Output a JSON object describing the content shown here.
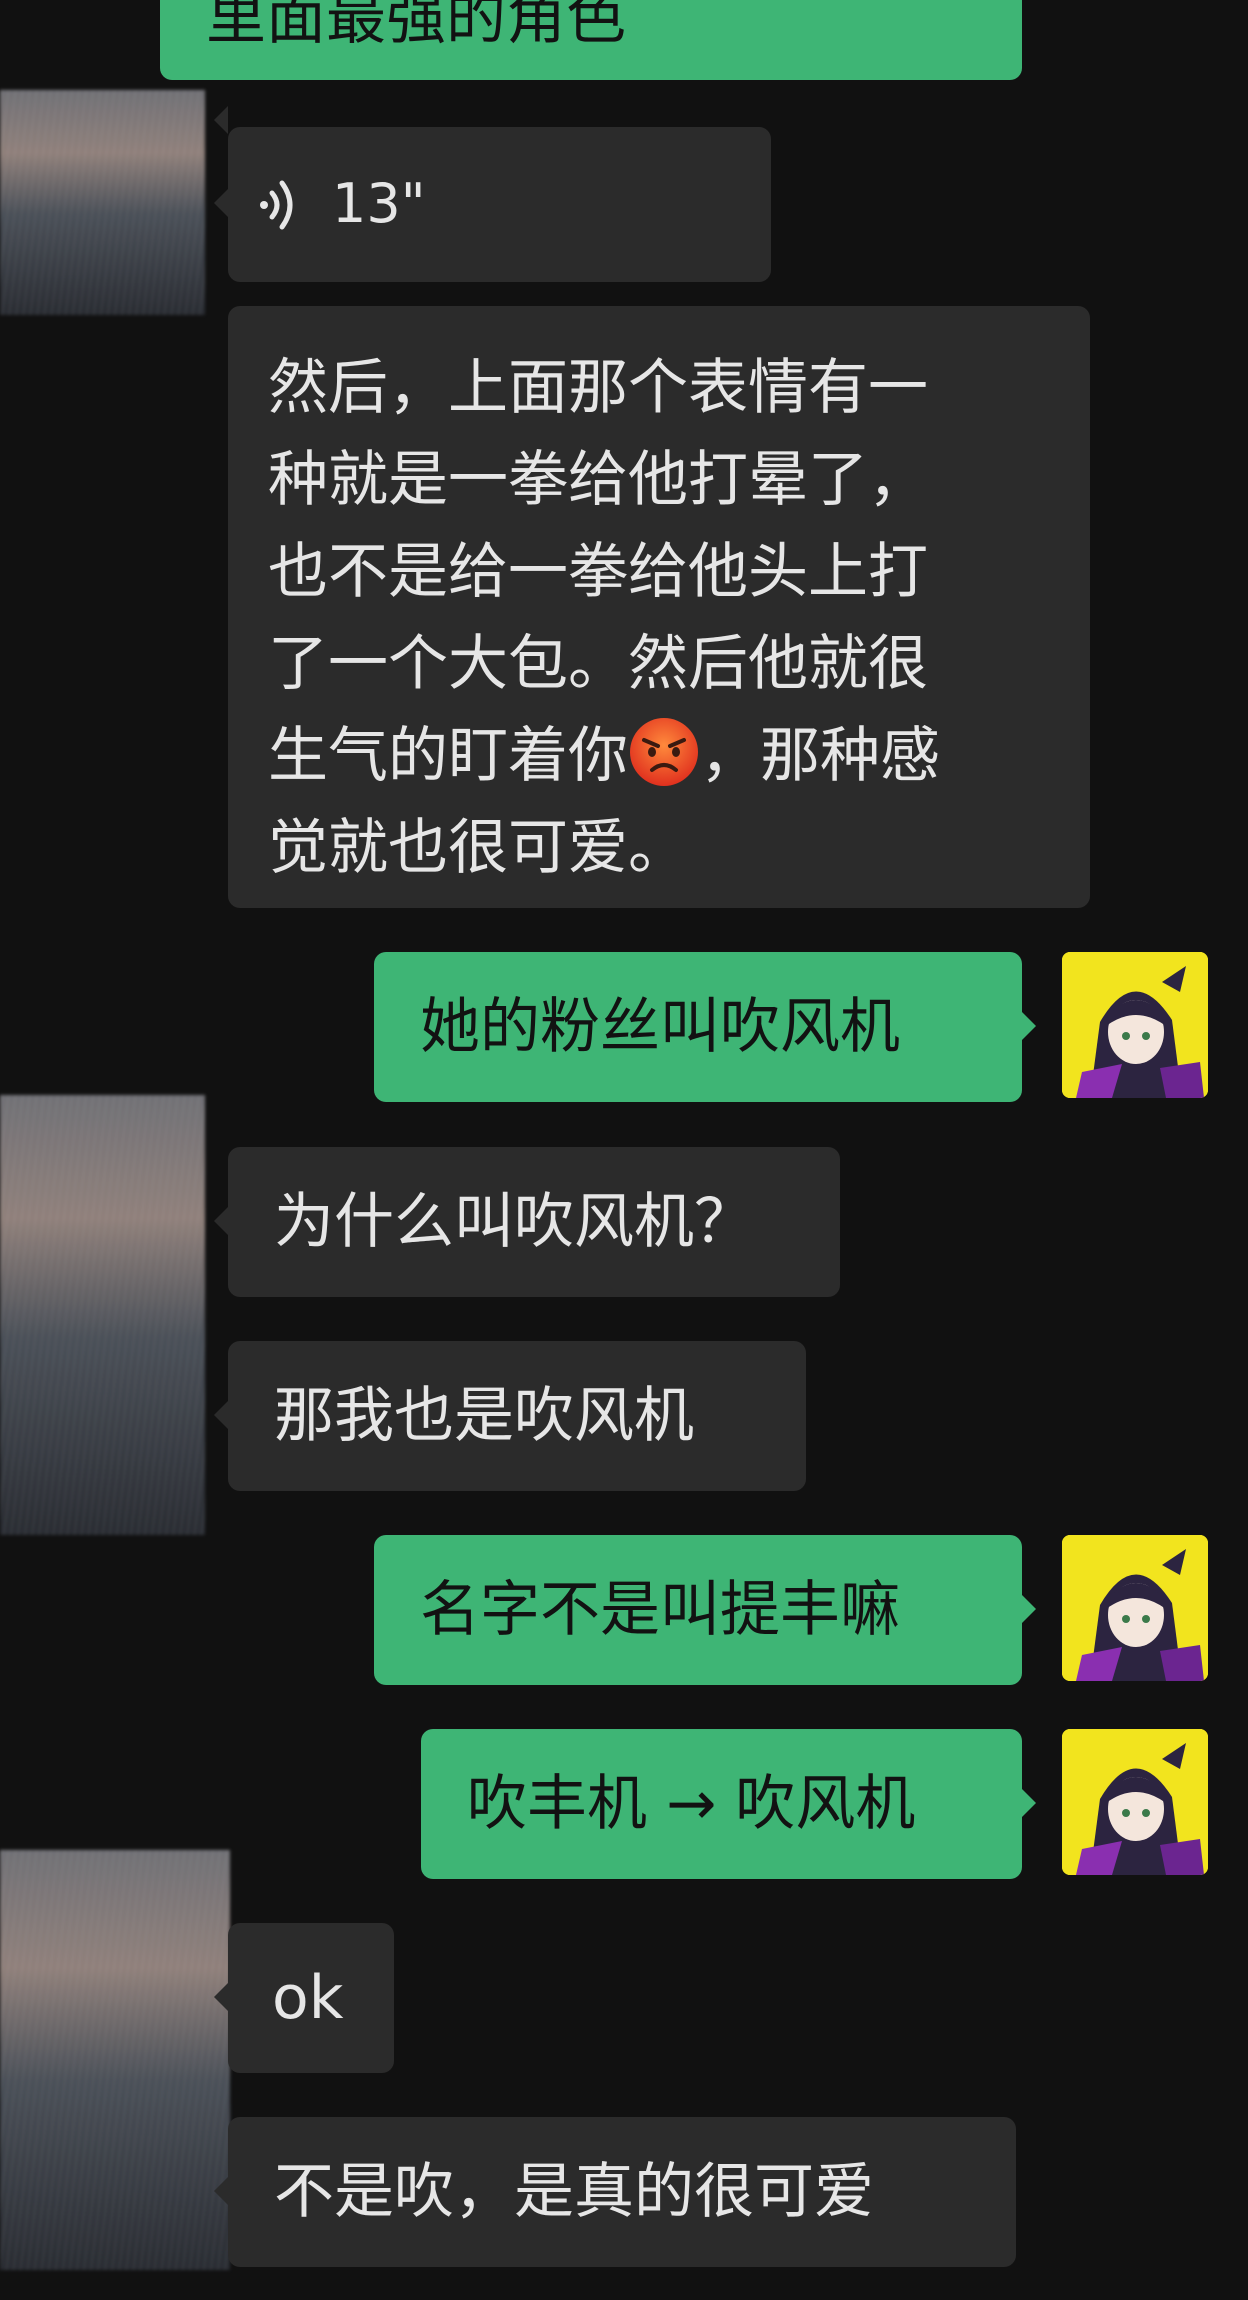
{
  "chat": {
    "messages": [
      {
        "id": "m0",
        "side": "out",
        "text": "里面最强的角色"
      },
      {
        "id": "m1",
        "side": "in",
        "type": "voice",
        "duration": "13\""
      },
      {
        "id": "m2",
        "side": "in",
        "lines": [
          "然后，上面那个表情有一",
          "种就是一拳给他打晕了，",
          "也不是给一拳给他头上打",
          "了一个大包。然后他就很",
          "生气的盯着你",
          "觉就也很可爱。"
        ],
        "line5_after_emoji": "，那种感",
        "emoji": "angry-face-emoji"
      },
      {
        "id": "m3",
        "side": "out",
        "text": "她的粉丝叫吹风机"
      },
      {
        "id": "m4",
        "side": "in",
        "text": "为什么叫吹风机？"
      },
      {
        "id": "m5",
        "side": "in",
        "text": "那我也是吹风机"
      },
      {
        "id": "m6",
        "side": "out",
        "text": "名字不是叫提丰嘛"
      },
      {
        "id": "m7",
        "side": "out",
        "text": "吹丰机 → 吹风机"
      },
      {
        "id": "m8",
        "side": "in",
        "text": "ok"
      },
      {
        "id": "m9",
        "side": "in",
        "text": "不是吹，是真的很可爱"
      }
    ]
  },
  "colors": {
    "background": "#111111",
    "incoming_bubble": "#2b2b2b",
    "outgoing_bubble": "#3eb575",
    "incoming_text": "#e6e6e6",
    "outgoing_text": "#121212"
  }
}
